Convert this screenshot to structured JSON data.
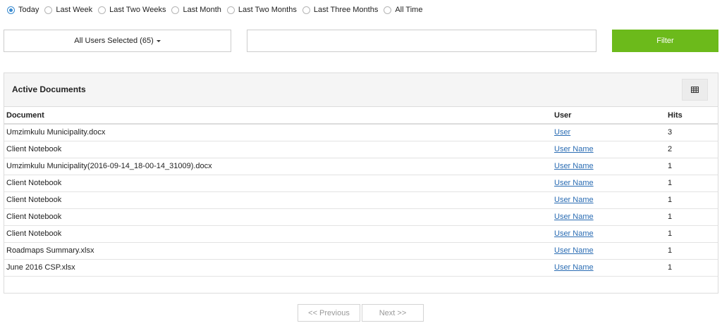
{
  "date_range": {
    "options": [
      {
        "label": "Today",
        "checked": true
      },
      {
        "label": "Last Week",
        "checked": false
      },
      {
        "label": "Last Two Weeks",
        "checked": false
      },
      {
        "label": "Last Month",
        "checked": false
      },
      {
        "label": "Last Two Months",
        "checked": false
      },
      {
        "label": "Last Three Months",
        "checked": false
      },
      {
        "label": "All Time",
        "checked": false
      }
    ]
  },
  "filters": {
    "users_select_label": "All Users Selected (65)",
    "search_value": "",
    "filter_button": "Filter"
  },
  "panel": {
    "title": "Active Documents",
    "grid_icon": "table-grid-icon",
    "columns": {
      "document": "Document",
      "user": "User",
      "hits": "Hits"
    },
    "rows": [
      {
        "document": "Umzimkulu Municipality.docx",
        "user": "User",
        "hits": "3"
      },
      {
        "document": "Client Notebook",
        "user": "User Name",
        "hits": "2"
      },
      {
        "document": "Umzimkulu Municipality(2016-09-14_18-00-14_31009).docx",
        "user": "User Name",
        "hits": "1"
      },
      {
        "document": "Client Notebook",
        "user": "User Name",
        "hits": "1"
      },
      {
        "document": "Client Notebook",
        "user": "User Name",
        "hits": "1"
      },
      {
        "document": "Client Notebook",
        "user": "User Name",
        "hits": "1"
      },
      {
        "document": "Client Notebook",
        "user": "User Name",
        "hits": "1"
      },
      {
        "document": "Roadmaps Summary.xlsx",
        "user": "User Name",
        "hits": "1"
      },
      {
        "document": "June 2016 CSP.xlsx",
        "user": "User Name",
        "hits": "1"
      }
    ]
  },
  "pagination": {
    "previous": "<< Previous",
    "next": "Next >>"
  },
  "colors": {
    "accent_green": "#6cba1b",
    "link_blue": "#2a6cb3",
    "radio_blue": "#3a8bd0"
  }
}
